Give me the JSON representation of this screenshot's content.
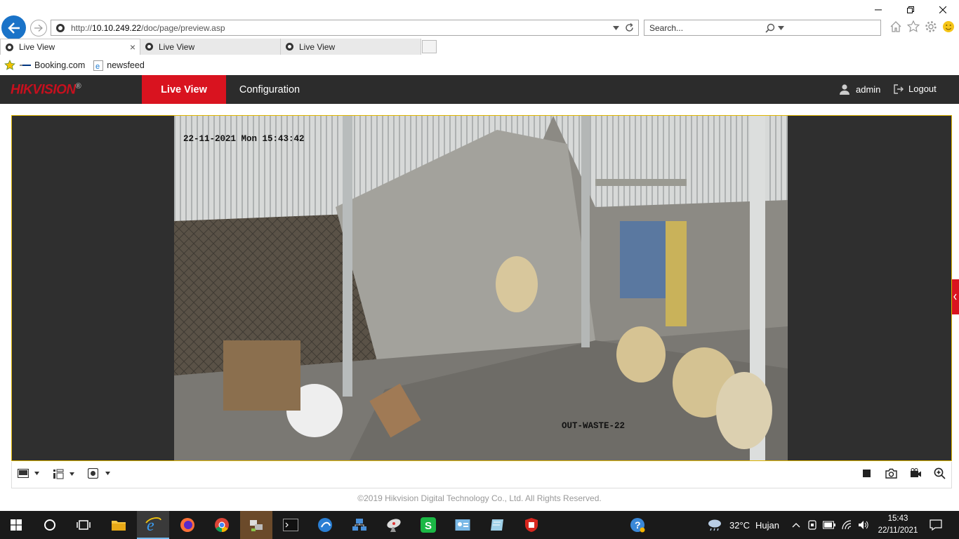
{
  "browser": {
    "url_prefix": "http://",
    "url_host": "10.10.249.22",
    "url_path": "/doc/page/preview.asp",
    "search_placeholder": "Search...",
    "tabs": [
      {
        "label": "Live View",
        "active": true
      },
      {
        "label": "Live View",
        "active": false
      },
      {
        "label": "Live View",
        "active": false
      }
    ],
    "favorites": [
      {
        "label": "Booking.com",
        "icon": "booking-icon"
      },
      {
        "label": "newsfeed",
        "icon": "ie-page-icon"
      }
    ]
  },
  "app": {
    "brand": "HIKVISION",
    "brand_mark": "®",
    "brand_color": "#c6101e",
    "nav": {
      "live_view": "Live View",
      "configuration": "Configuration"
    },
    "user": "admin",
    "logout": "Logout",
    "accent": "#d9131f"
  },
  "video": {
    "osd_time": "22-11-2021 Mon 15:43:42",
    "osd_name": "OUT-WASTE-22"
  },
  "footer": {
    "copyright": "©2019 Hikvision Digital Technology Co., Ltd. All Rights Reserved."
  },
  "taskbar": {
    "weather_temp": "32°C",
    "weather_desc": "Hujan",
    "time": "15:43",
    "date": "22/11/2021"
  }
}
